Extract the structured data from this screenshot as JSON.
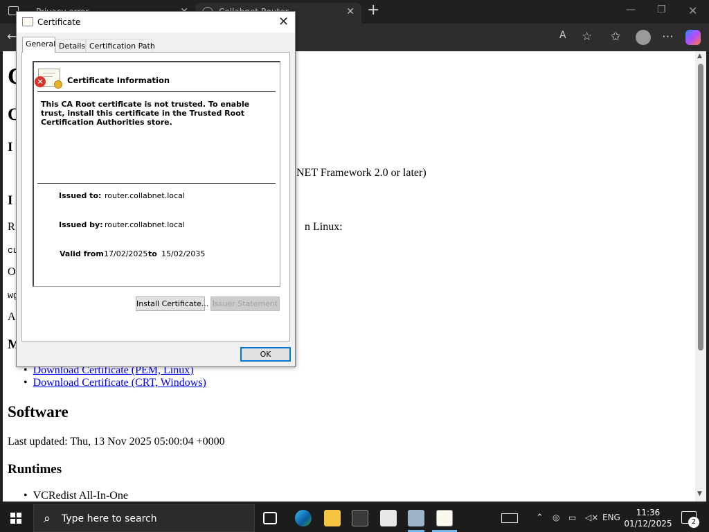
{
  "browser": {
    "tabs": [
      {
        "title": "Privacy error"
      },
      {
        "title": "Collabnet Router"
      }
    ]
  },
  "page": {
    "heading_partial_1": "C",
    "heading_partial_2": "C",
    "heading_partial_3": "I",
    "line_framework": ".NET Framework 2.0 or later)",
    "heading_partial_4": "I",
    "line_r": "R",
    "line_linux": "n Linux:",
    "code_cu": "cu",
    "line_o": "O",
    "code_wg": "wg",
    "line_a": "A",
    "heading_m": "M",
    "links": [
      {
        "text": "Download Certificate (PEM, Linux)"
      },
      {
        "text": "Download Certificate (CRT, Windows)"
      }
    ],
    "software_heading": "Software",
    "last_updated": "Last updated: Thu, 13 Nov 2025 05:00:04 +0000",
    "runtimes_heading": "Runtimes",
    "runtime_items": [
      {
        "text": "VCRedist All-In-One"
      }
    ]
  },
  "dialog": {
    "title": "Certificate",
    "tabs": [
      {
        "label": "General"
      },
      {
        "label": "Details"
      },
      {
        "label": "Certification Path"
      }
    ],
    "info_title": "Certificate Information",
    "trust_message": "This CA Root certificate is not trusted. To enable trust, install this certificate in the Trusted Root Certification Authorities store.",
    "issued_to_label": "Issued to:",
    "issued_to": "router.collabnet.local",
    "issued_by_label": "Issued by:",
    "issued_by": "router.collabnet.local",
    "valid_from_label": "Valid from",
    "valid_from": "17/02/2025",
    "to_label": "to",
    "valid_to": "15/02/2035",
    "install_button": "Install Certificate...",
    "issuer_button": "Issuer Statement",
    "ok_button": "OK"
  },
  "taskbar": {
    "search_placeholder": "Type here to search",
    "language": "ENG",
    "time": "11:36",
    "date": "01/12/2025",
    "notification_count": "2"
  }
}
